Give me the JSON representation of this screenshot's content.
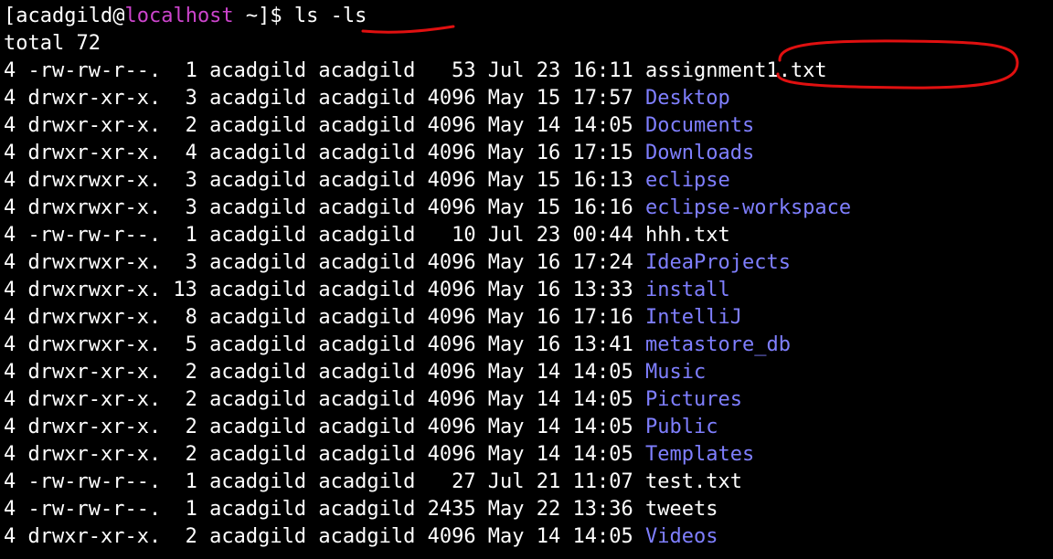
{
  "prompt": {
    "user": "acadgild",
    "at": "@",
    "host": "localhost",
    "suffix": " ~]$ ",
    "command": "ls -ls",
    "open_bracket": "["
  },
  "total_line": "total 72",
  "entries": [
    {
      "prefix": "4 -rw-rw-r--.  1 acadgild acadgild   53 Jul 23 16:11 ",
      "name": "assignment1.txt",
      "kind": "file"
    },
    {
      "prefix": "4 drwxr-xr-x.  3 acadgild acadgild 4096 May 15 17:57 ",
      "name": "Desktop",
      "kind": "dir"
    },
    {
      "prefix": "4 drwxr-xr-x.  2 acadgild acadgild 4096 May 14 14:05 ",
      "name": "Documents",
      "kind": "dir"
    },
    {
      "prefix": "4 drwxr-xr-x.  4 acadgild acadgild 4096 May 16 17:15 ",
      "name": "Downloads",
      "kind": "dir"
    },
    {
      "prefix": "4 drwxrwxr-x.  3 acadgild acadgild 4096 May 15 16:13 ",
      "name": "eclipse",
      "kind": "dir"
    },
    {
      "prefix": "4 drwxrwxr-x.  3 acadgild acadgild 4096 May 15 16:16 ",
      "name": "eclipse-workspace",
      "kind": "dir"
    },
    {
      "prefix": "4 -rw-rw-r--.  1 acadgild acadgild   10 Jul 23 00:44 ",
      "name": "hhh.txt",
      "kind": "file"
    },
    {
      "prefix": "4 drwxrwxr-x.  3 acadgild acadgild 4096 May 16 17:24 ",
      "name": "IdeaProjects",
      "kind": "dir"
    },
    {
      "prefix": "4 drwxrwxr-x. 13 acadgild acadgild 4096 May 16 13:33 ",
      "name": "install",
      "kind": "dir"
    },
    {
      "prefix": "4 drwxrwxr-x.  8 acadgild acadgild 4096 May 16 17:16 ",
      "name": "IntelliJ",
      "kind": "dir"
    },
    {
      "prefix": "4 drwxrwxr-x.  5 acadgild acadgild 4096 May 16 13:41 ",
      "name": "metastore_db",
      "kind": "dir"
    },
    {
      "prefix": "4 drwxr-xr-x.  2 acadgild acadgild 4096 May 14 14:05 ",
      "name": "Music",
      "kind": "dir"
    },
    {
      "prefix": "4 drwxr-xr-x.  2 acadgild acadgild 4096 May 14 14:05 ",
      "name": "Pictures",
      "kind": "dir"
    },
    {
      "prefix": "4 drwxr-xr-x.  2 acadgild acadgild 4096 May 14 14:05 ",
      "name": "Public",
      "kind": "dir"
    },
    {
      "prefix": "4 drwxr-xr-x.  2 acadgild acadgild 4096 May 14 14:05 ",
      "name": "Templates",
      "kind": "dir"
    },
    {
      "prefix": "4 -rw-rw-r--.  1 acadgild acadgild   27 Jul 21 11:07 ",
      "name": "test.txt",
      "kind": "file"
    },
    {
      "prefix": "4 -rw-rw-r--.  1 acadgild acadgild 2435 May 22 13:36 ",
      "name": "tweets",
      "kind": "file"
    },
    {
      "prefix": "4 drwxr-xr-x.  2 acadgild acadgild 4096 May 14 14:05 ",
      "name": "Videos",
      "kind": "dir"
    }
  ],
  "colors": {
    "background": "#000000",
    "text": "#ffffff",
    "host": "#cc44cc",
    "directory": "#7f7fff",
    "annotation": "#e01010"
  }
}
